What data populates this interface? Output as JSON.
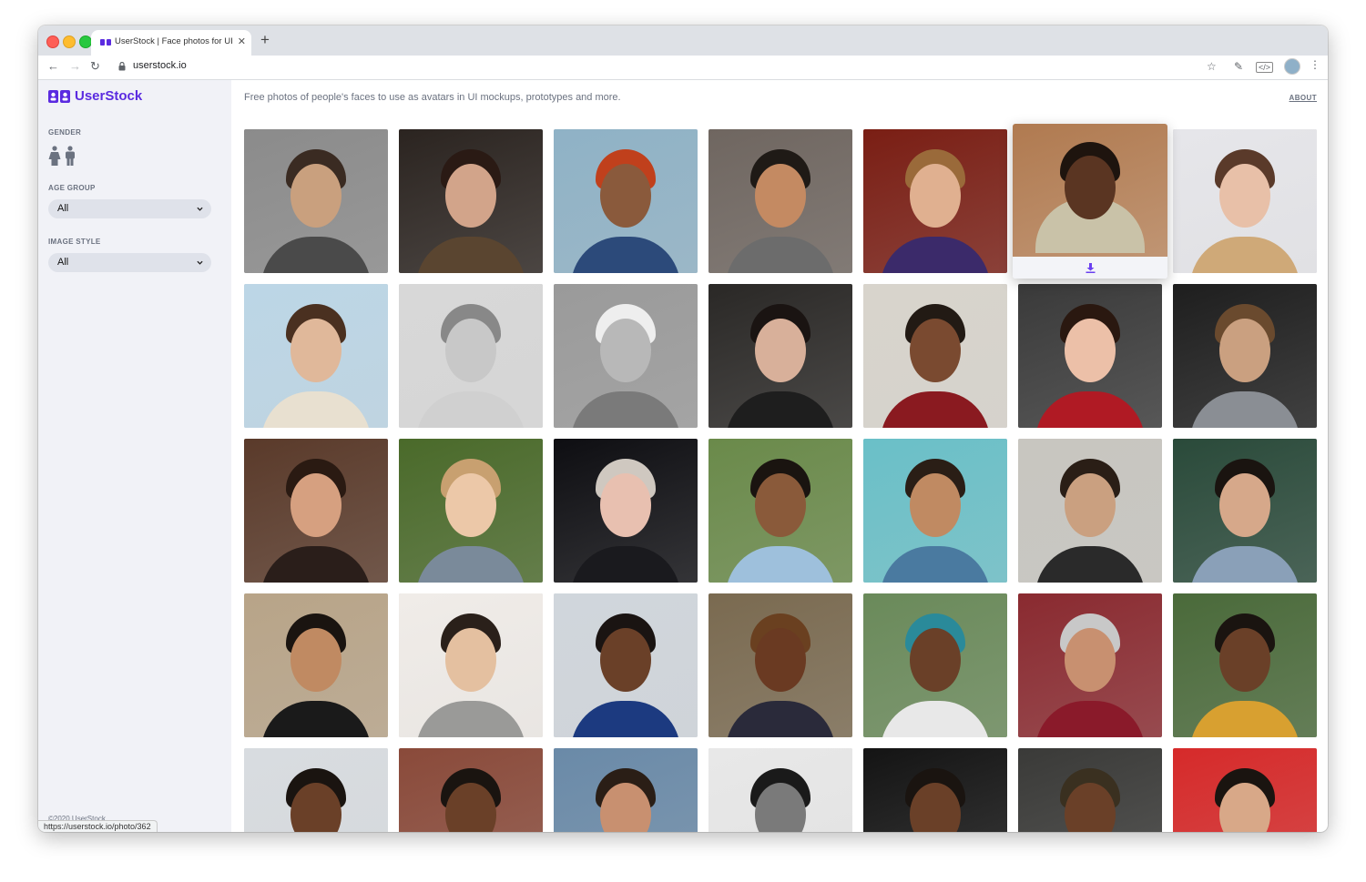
{
  "browser": {
    "tab_title": "UserStock | Face photos for UI",
    "tab_close": "✕",
    "new_tab": "+",
    "url": "userstock.io",
    "status_url": "https://userstock.io/photo/362"
  },
  "sidebar": {
    "logo_text": "UserStock",
    "gender_label": "GENDER",
    "age_label": "AGE GROUP",
    "age_value": "All",
    "style_label": "IMAGE STYLE",
    "style_value": "All",
    "copyright": "©2020 UserStock"
  },
  "header": {
    "tagline": "Free photos of people's faces to use as avatars in UI mockups, prototypes and more.",
    "about": "ABOUT"
  },
  "colors": {
    "brand": "#5b2be0",
    "sidebar_bg": "#f1f2f7"
  }
}
